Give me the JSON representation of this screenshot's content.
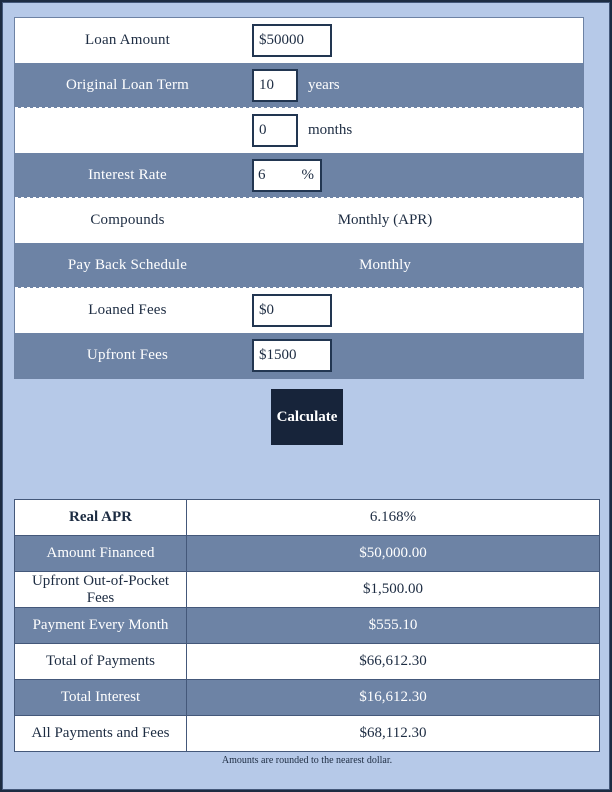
{
  "form": {
    "rows": [
      {
        "label": "Loan Amount",
        "kind": "input",
        "value": "$50000",
        "unit": "",
        "shade": "white"
      },
      {
        "label": "Original Loan Term",
        "kind": "input",
        "value": "10",
        "unit": "years",
        "shade": "blue"
      },
      {
        "label": "",
        "kind": "input",
        "value": "0",
        "unit": "months",
        "shade": "white"
      },
      {
        "label": "Interest Rate",
        "kind": "rate",
        "value": "6",
        "unit": "%",
        "shade": "blue"
      },
      {
        "label": "Compounds",
        "kind": "static",
        "value": "Monthly (APR)",
        "unit": "",
        "shade": "white"
      },
      {
        "label": "Pay Back Schedule",
        "kind": "static",
        "value": "Monthly",
        "unit": "",
        "shade": "blue"
      },
      {
        "label": "Loaned Fees",
        "kind": "input",
        "value": "$0",
        "unit": "",
        "shade": "white"
      },
      {
        "label": "Upfront Fees",
        "kind": "input",
        "value": "$1500",
        "unit": "",
        "shade": "blue"
      }
    ]
  },
  "calculate_label": "Calculate",
  "results": {
    "rows": [
      {
        "label": "Real APR",
        "value": "6.168%",
        "shade": "white"
      },
      {
        "label": "Amount Financed",
        "value": "$50,000.00",
        "shade": "blue"
      },
      {
        "label": "Upfront Out-of-Pocket Fees",
        "value": "$1,500.00",
        "shade": "white"
      },
      {
        "label": "Payment Every Month",
        "value": "$555.10",
        "shade": "blue"
      },
      {
        "label": "Total of Payments",
        "value": "$66,612.30",
        "shade": "white"
      },
      {
        "label": "Total Interest",
        "value": "$16,612.30",
        "shade": "blue"
      },
      {
        "label": "All Payments and Fees",
        "value": "$68,112.30",
        "shade": "white"
      }
    ]
  },
  "footnote": "Amounts are rounded to the nearest dollar.",
  "colors": {
    "page_background": "#b6c9e8",
    "row_blue": "#6d83a5",
    "row_white": "#ffffff",
    "text_dark": "#1d2c42",
    "button_background": "#17243a",
    "border": "#44587a"
  }
}
